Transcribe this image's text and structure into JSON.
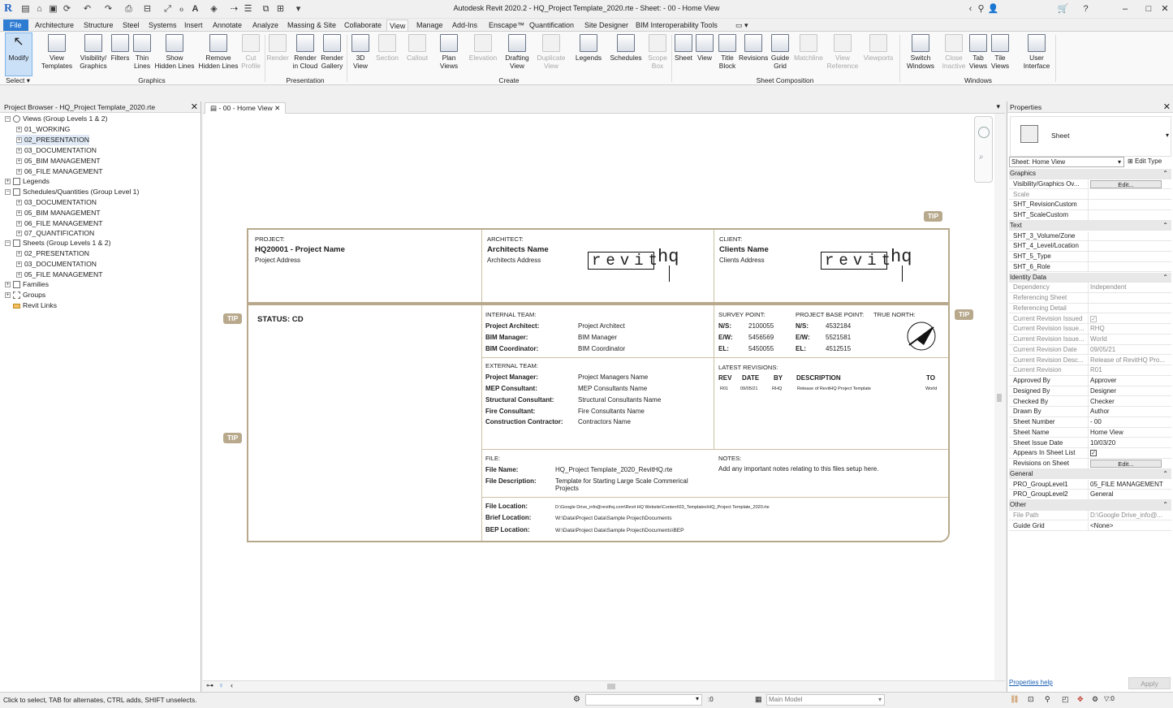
{
  "window": {
    "title": "Autodesk Revit 2020.2 - HQ_Project Template_2020.rte - Sheet: - 00 - Home View"
  },
  "ribbon_tabs": [
    "File",
    "Architecture",
    "Structure",
    "Steel",
    "Systems",
    "Insert",
    "Annotate",
    "Analyze",
    "Massing & Site",
    "Collaborate",
    "View",
    "Manage",
    "Add-Ins",
    "Enscape™",
    "Quantification",
    "Site Designer",
    "BIM Interoperability Tools"
  ],
  "active_tab": "View",
  "tools": {
    "modify": "Modify",
    "select": "Select ▾",
    "view_templates": [
      "View",
      "Templates"
    ],
    "visibility_graphics": [
      "Visibility/",
      "Graphics"
    ],
    "filters": [
      "Filters",
      ""
    ],
    "thin_lines": [
      "Thin",
      "Lines"
    ],
    "show_hidden": [
      "Show",
      "Hidden Lines"
    ],
    "remove_hidden": [
      "Remove",
      "Hidden Lines"
    ],
    "cut_profile": [
      "Cut",
      "Profile"
    ],
    "render": [
      "Render",
      ""
    ],
    "render_cloud": [
      "Render",
      "in Cloud"
    ],
    "render_gallery": [
      "Render",
      "Gallery"
    ],
    "view_3d": [
      "3D",
      "View"
    ],
    "section": [
      "Section",
      ""
    ],
    "callout": [
      "Callout",
      ""
    ],
    "plan_views": [
      "Plan",
      "Views"
    ],
    "elevation": [
      "Elevation",
      ""
    ],
    "drafting_view": [
      "Drafting",
      "View"
    ],
    "duplicate_view": [
      "Duplicate",
      "View"
    ],
    "legends": [
      "Legends",
      ""
    ],
    "schedules": [
      "Schedules",
      ""
    ],
    "scope_box": [
      "Scope",
      "Box"
    ],
    "sheet": [
      "Sheet",
      ""
    ],
    "view": [
      "View",
      ""
    ],
    "title_block": [
      "Title",
      "Block"
    ],
    "revisions": [
      "Revisions",
      ""
    ],
    "guide_grid": [
      "Guide",
      "Grid"
    ],
    "matchline": [
      "Matchline",
      ""
    ],
    "view_reference": [
      "View",
      "Reference"
    ],
    "viewports": [
      "Viewports",
      ""
    ],
    "switch_windows": [
      "Switch",
      "Windows"
    ],
    "close_inactive": [
      "Close",
      "Inactive"
    ],
    "tab_views": [
      "Tab",
      "Views"
    ],
    "tile_views": [
      "Tile",
      "Views"
    ],
    "user_interface": [
      "User",
      "Interface"
    ]
  },
  "panels": {
    "graphics": "Graphics",
    "presentation": "Presentation",
    "create": "Create",
    "sheet_composition": "Sheet Composition",
    "windows": "Windows"
  },
  "project_browser": {
    "title": "Project Browser - HQ_Project Template_2020.rte",
    "nodes": [
      {
        "label": "Views (Group Levels 1 & 2)"
      },
      {
        "label": "01_WORKING"
      },
      {
        "label": "02_PRESENTATION"
      },
      {
        "label": "03_DOCUMENTATION"
      },
      {
        "label": "05_BIM MANAGEMENT"
      },
      {
        "label": "06_FILE MANAGEMENT"
      },
      {
        "label": "Legends"
      },
      {
        "label": "Schedules/Quantities (Group Level 1)"
      },
      {
        "label": "03_DOCUMENTATION"
      },
      {
        "label": "05_BIM MANAGEMENT"
      },
      {
        "label": "06_FILE MANAGEMENT"
      },
      {
        "label": "07_QUANTIFICATION"
      },
      {
        "label": "Sheets (Group Levels 1 & 2)"
      },
      {
        "label": "02_PRESENTATION"
      },
      {
        "label": "03_DOCUMENTATION"
      },
      {
        "label": "05_FILE MANAGEMENT"
      },
      {
        "label": "Families"
      },
      {
        "label": "Groups"
      },
      {
        "label": "Revit Links"
      }
    ]
  },
  "view_tab": "- 00 - Home View",
  "tip": "TIP",
  "sheet": {
    "project_label": "PROJECT:",
    "project_name": "HQ20001 - Project Name",
    "project_address": "Project Address",
    "architect_label": "ARCHITECT:",
    "architect_name": "Architects Name",
    "architect_address": "Architects Address",
    "client_label": "CLIENT:",
    "client_name": "Clients Name",
    "client_address": "Clients Address",
    "logo_text": "revit",
    "logo_hq": "hq",
    "status": "STATUS: CD",
    "internal_team_label": "INTERNAL TEAM:",
    "internal": [
      {
        "role": "Project Architect:",
        "name": "Project Architect"
      },
      {
        "role": "BIM Manager:",
        "name": "BIM Manager"
      },
      {
        "role": "BIM Coordinator:",
        "name": "BIM Coordinator"
      }
    ],
    "survey_label": "SURVEY POINT:",
    "base_label": "PROJECT BASE POINT:",
    "north_label": "TRUE NORTH:",
    "survey": [
      {
        "k": "N/S:",
        "v": "2100055"
      },
      {
        "k": "E/W:",
        "v": "5456569"
      },
      {
        "k": "EL:",
        "v": "5450055"
      }
    ],
    "base": [
      {
        "k": "N/S:",
        "v": "4532184"
      },
      {
        "k": "E/W:",
        "v": "5521581"
      },
      {
        "k": "EL:",
        "v": "4512515"
      }
    ],
    "external_team_label": "EXTERNAL TEAM:",
    "external": [
      {
        "role": "Project Manager:",
        "name": "Project Managers Name"
      },
      {
        "role": "MEP Consultant:",
        "name": "MEP Consultants Name"
      },
      {
        "role": "Structural Consultant:",
        "name": "Structural Consultants Name"
      },
      {
        "role": "Fire Consultant:",
        "name": "Fire Consultants Name"
      },
      {
        "role": "Construction Contractor:",
        "name": "Contractors Name"
      }
    ],
    "latest_revisions_label": "LATEST REVISIONS:",
    "rev_headers": {
      "rev": "REV",
      "date": "DATE",
      "by": "BY",
      "desc": "DESCRIPTION",
      "to": "TO"
    },
    "rev_row": {
      "rev": "R01",
      "date": "09/05/21",
      "by": "RHQ",
      "desc": "Release of RevitHQ Project Template",
      "to": "World"
    },
    "file_label": "FILE:",
    "file_name_label": "File Name:",
    "file_name": "HQ_Project Template_2020_RevitHQ.rte",
    "file_desc_label": "File Description:",
    "file_desc_1": "Template for Starting Large Scale Commerical",
    "file_desc_2": "Projects",
    "notes_label": "NOTES:",
    "notes": "Add any important notes relating to this files setup here.",
    "file_location_label": "File Location:",
    "file_location": "D:\\Google Drive_info@revithq.com\\Revit HQ Website\\Content\\03_Templates\\HQ_Project Template_2020.rte",
    "brief_location_label": "Brief Location:",
    "brief_location": "W:\\Data\\Project Data\\Sample Project\\Documents",
    "bep_location_label": "BEP Location:",
    "bep_location": "W:\\Data\\Project Data\\Sample Project\\Documents\\BEP"
  },
  "properties": {
    "title": "Properties",
    "type_name": "Sheet",
    "instance": "Sheet: Home View",
    "edit_type": "Edit Type",
    "edit": "Edit...",
    "rows": [
      {
        "k": "Graphics",
        "grp": true
      },
      {
        "k": "Visibility/Graphics Ov...",
        "v": "",
        "btn": true
      },
      {
        "k": "Scale",
        "v": "",
        "dis": true
      },
      {
        "k": "SHT_RevisionCustom",
        "v": ""
      },
      {
        "k": "SHT_ScaleCustom",
        "v": ""
      },
      {
        "k": "Text",
        "grp": true
      },
      {
        "k": "SHT_3_Volume/Zone",
        "v": ""
      },
      {
        "k": "SHT_4_Level/Location",
        "v": ""
      },
      {
        "k": "SHT_5_Type",
        "v": ""
      },
      {
        "k": "SHT_6_Role",
        "v": ""
      },
      {
        "k": "Identity Data",
        "grp": true
      },
      {
        "k": "Dependency",
        "v": "Independent",
        "dis": true
      },
      {
        "k": "Referencing Sheet",
        "v": "",
        "dis": true
      },
      {
        "k": "Referencing Detail",
        "v": "",
        "dis": true
      },
      {
        "k": "Current Revision Issued",
        "v": "",
        "dis": true,
        "check": true
      },
      {
        "k": "Current Revision Issue...",
        "v": "RHQ",
        "dis": true
      },
      {
        "k": "Current Revision Issue...",
        "v": "World",
        "dis": true
      },
      {
        "k": "Current Revision Date",
        "v": "09/05/21",
        "dis": true
      },
      {
        "k": "Current Revision Desc...",
        "v": "Release of RevitHQ Pro...",
        "dis": true
      },
      {
        "k": "Current Revision",
        "v": "R01",
        "dis": true
      },
      {
        "k": "Approved By",
        "v": "Approver"
      },
      {
        "k": "Designed By",
        "v": "Designer"
      },
      {
        "k": "Checked By",
        "v": "Checker"
      },
      {
        "k": "Drawn By",
        "v": "Author"
      },
      {
        "k": "Sheet Number",
        "v": "- 00"
      },
      {
        "k": "Sheet Name",
        "v": "Home View"
      },
      {
        "k": "Sheet Issue Date",
        "v": "10/03/20"
      },
      {
        "k": "Appears In Sheet List",
        "v": "",
        "check": true
      },
      {
        "k": "Revisions on Sheet",
        "v": "",
        "btn": true
      },
      {
        "k": "General",
        "grp": true
      },
      {
        "k": "PRO_GroupLevel1",
        "v": "05_FILE MANAGEMENT"
      },
      {
        "k": "PRO_GroupLevel2",
        "v": "General"
      },
      {
        "k": "Other",
        "grp": true
      },
      {
        "k": "File Path",
        "v": "D:\\Google Drive_info@...",
        "dis": true
      },
      {
        "k": "Guide Grid",
        "v": "<None>"
      }
    ],
    "help": "Properties help",
    "apply": "Apply"
  },
  "status": {
    "hint": "Click to select, TAB for alternates, CTRL adds, SHIFT unselects.",
    "coord": ":0",
    "model": "Main Model",
    "filter_count": ":0"
  }
}
